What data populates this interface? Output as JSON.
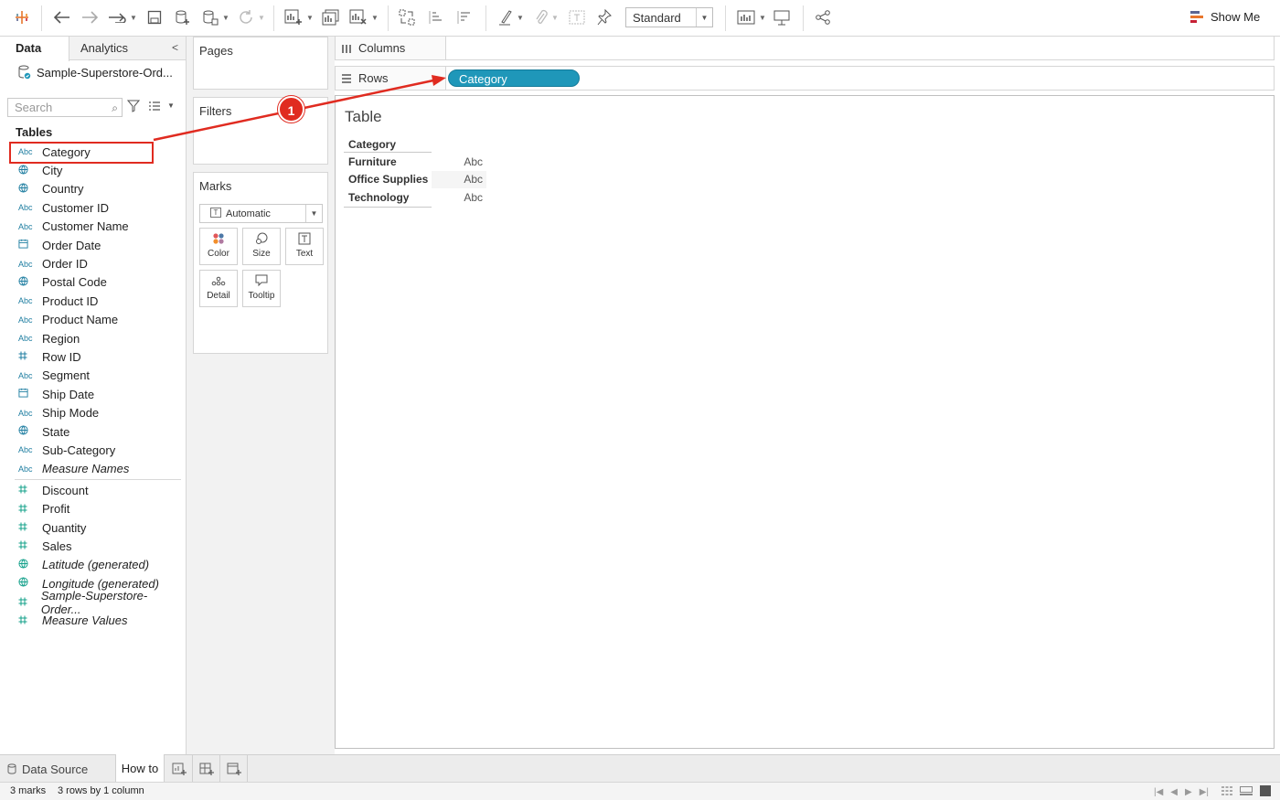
{
  "toolbar": {
    "view_mode": "Standard",
    "show_me": "Show Me",
    "icons": [
      "tableau-logo-icon",
      "undo-icon",
      "redo-icon",
      "redo-dropdown-icon",
      "save-icon",
      "new-datasource-icon",
      "pause-updates-icon",
      "refresh-icon",
      "new-worksheet-icon",
      "duplicate-sheet-icon",
      "clear-sheet-icon",
      "swap-icon",
      "sort-asc-icon",
      "sort-desc-icon",
      "highlight-icon",
      "group-icon",
      "labels-icon",
      "pin-icon",
      "fit-icon",
      "presentation-icon",
      "share-icon"
    ]
  },
  "datapane": {
    "tab_data": "Data",
    "tab_analytics": "Analytics",
    "datasource": "Sample-Superstore-Ord...",
    "search_placeholder": "Search",
    "tables_header": "Tables",
    "dimensions": [
      {
        "label": "Category",
        "type": "Abc"
      },
      {
        "label": "City",
        "type": "geo"
      },
      {
        "label": "Country",
        "type": "geo"
      },
      {
        "label": "Customer ID",
        "type": "Abc"
      },
      {
        "label": "Customer Name",
        "type": "Abc"
      },
      {
        "label": "Order Date",
        "type": "date"
      },
      {
        "label": "Order ID",
        "type": "Abc"
      },
      {
        "label": "Postal Code",
        "type": "geo"
      },
      {
        "label": "Product ID",
        "type": "Abc"
      },
      {
        "label": "Product Name",
        "type": "Abc"
      },
      {
        "label": "Region",
        "type": "Abc"
      },
      {
        "label": "Row ID",
        "type": "num"
      },
      {
        "label": "Segment",
        "type": "Abc"
      },
      {
        "label": "Ship Date",
        "type": "date"
      },
      {
        "label": "Ship Mode",
        "type": "Abc"
      },
      {
        "label": "State",
        "type": "geo"
      },
      {
        "label": "Sub-Category",
        "type": "Abc"
      },
      {
        "label": "Measure Names",
        "type": "Abc",
        "italic": true
      }
    ],
    "measures": [
      {
        "label": "Discount",
        "type": "num"
      },
      {
        "label": "Profit",
        "type": "num"
      },
      {
        "label": "Quantity",
        "type": "num"
      },
      {
        "label": "Sales",
        "type": "num"
      },
      {
        "label": "Latitude (generated)",
        "type": "geo",
        "italic": true
      },
      {
        "label": "Longitude (generated)",
        "type": "geo",
        "italic": true
      },
      {
        "label": "Sample-Superstore-Order...",
        "type": "num",
        "italic": true
      },
      {
        "label": "Measure Values",
        "type": "num",
        "italic": true
      }
    ],
    "abc_label": "Abc"
  },
  "cards": {
    "pages": "Pages",
    "filters": "Filters",
    "marks": "Marks",
    "mark_type": "Automatic",
    "buttons": {
      "color": "Color",
      "size": "Size",
      "text": "Text",
      "detail": "Detail",
      "tooltip": "Tooltip"
    }
  },
  "shelves": {
    "columns": "Columns",
    "rows": "Rows",
    "rows_pill": "Category"
  },
  "viz": {
    "title": "Table",
    "header": "Category",
    "rows": [
      {
        "category": "Furniture",
        "value": "Abc"
      },
      {
        "category": "Office Supplies",
        "value": "Abc"
      },
      {
        "category": "Technology",
        "value": "Abc"
      }
    ]
  },
  "annotation": {
    "step": "1",
    "color": "#e02b20"
  },
  "sheetbar": {
    "data_source": "Data Source",
    "current_sheet": "How to"
  },
  "status": {
    "marks": "3 marks",
    "dims": "3 rows by 1 column"
  },
  "colors": {
    "pill": "#1f97b9",
    "dimension": "#1f7ea1",
    "measure": "#13a08a",
    "annotation": "#e02b20"
  }
}
